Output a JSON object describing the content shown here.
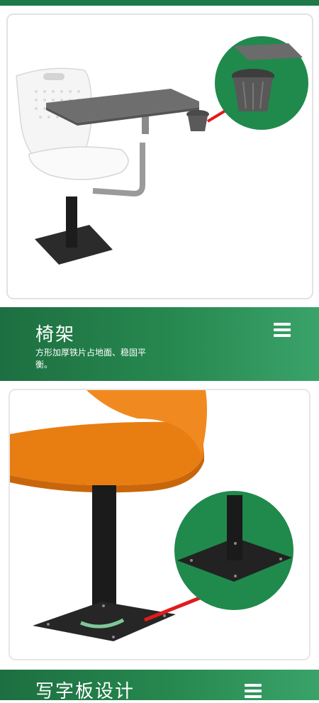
{
  "sections": [
    {
      "title": "椅架",
      "description": "方形加厚铁片占地面、稳固平衡。"
    },
    {
      "title": "写字板设计"
    }
  ],
  "colors": {
    "brand_green": "#1e7a46",
    "seat_white": "#f4f4f4",
    "seat_orange": "#e87d12",
    "tablet_gray": "#6c6c6c",
    "arrow_red": "#e11b1b"
  },
  "icons": [
    "menu-icon",
    "cup-holder-zoom",
    "base-plate-zoom",
    "red-arrow"
  ]
}
